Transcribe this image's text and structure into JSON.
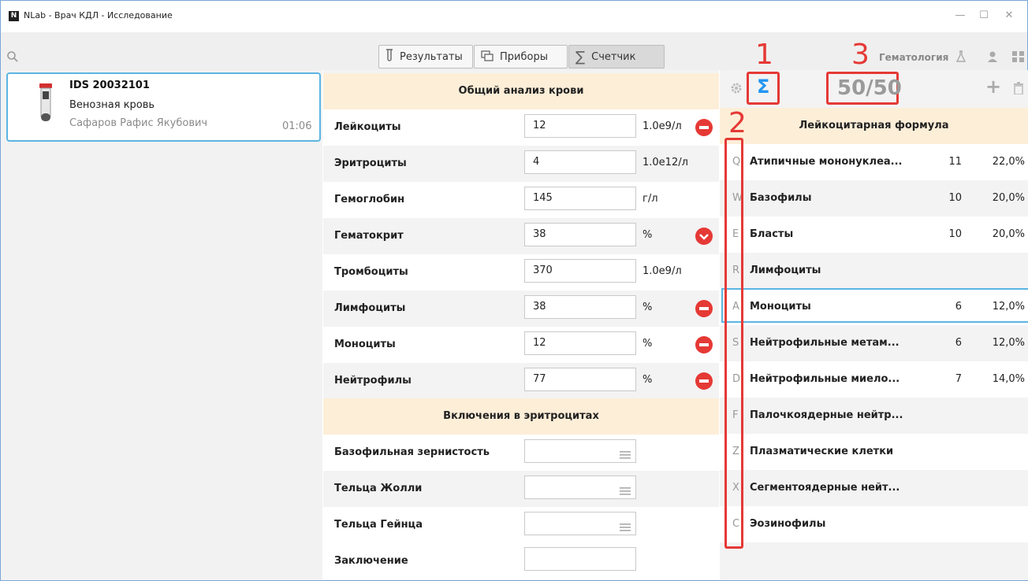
{
  "window": {
    "logo_letter": "N",
    "title": "NLab - Врач КДЛ - Исследование",
    "minimize": "—",
    "maximize": "☐",
    "close": "✕"
  },
  "toolbar": {
    "results_label": "Результаты",
    "devices_label": "Приборы",
    "counter_label": "Счетчик",
    "department": "Гематология"
  },
  "sample": {
    "id": "IDS 20032101",
    "material": "Венозная кровь",
    "patient": "Сафаров Рафис Якубович",
    "time": "01:06"
  },
  "cbc": {
    "section_title": "Общий анализ крови",
    "rows": [
      {
        "label": "Лейкоциты",
        "value": "12",
        "unit": "1.0e9/л",
        "flag": "high"
      },
      {
        "label": "Эритроциты",
        "value": "4",
        "unit": "1.0e12/л",
        "flag": ""
      },
      {
        "label": "Гемоглобин",
        "value": "145",
        "unit": "г/л",
        "flag": ""
      },
      {
        "label": "Гематокрит",
        "value": "38",
        "unit": "%",
        "flag": "low"
      },
      {
        "label": "Тромбоциты",
        "value": "370",
        "unit": "1.0e9/л",
        "flag": ""
      },
      {
        "label": "Лимфоциты",
        "value": "38",
        "unit": "%",
        "flag": "high"
      },
      {
        "label": "Моноциты",
        "value": "12",
        "unit": "%",
        "flag": "high"
      },
      {
        "label": "Нейтрофилы",
        "value": "77",
        "unit": "%",
        "flag": "high"
      }
    ]
  },
  "inclusions": {
    "section_title": "Включения в эритроцитах",
    "rows": [
      {
        "label": "Базофильная зернистость"
      },
      {
        "label": "Тельца Жолли"
      },
      {
        "label": "Тельца Гейнца"
      }
    ],
    "conclusion_label": "Заключение"
  },
  "counter": {
    "sigma": "Σ",
    "value": "50/50",
    "callouts": [
      "1",
      "2",
      "3"
    ],
    "section_title": "Лейкоцитарная формула",
    "rows": [
      {
        "key": "Q",
        "name": "Атипичные мононуклеа...",
        "count": "11",
        "pct": "22,0%"
      },
      {
        "key": "W",
        "name": "Базофилы",
        "count": "10",
        "pct": "20,0%"
      },
      {
        "key": "E",
        "name": "Бласты",
        "count": "10",
        "pct": "20,0%"
      },
      {
        "key": "R",
        "name": "Лимфоциты",
        "count": "",
        "pct": ""
      },
      {
        "key": "A",
        "name": "Моноциты",
        "count": "6",
        "pct": "12,0%"
      },
      {
        "key": "S",
        "name": "Нейтрофильные метам...",
        "count": "6",
        "pct": "12,0%"
      },
      {
        "key": "D",
        "name": "Нейтрофильные миело...",
        "count": "7",
        "pct": "14,0%"
      },
      {
        "key": "F",
        "name": "Палочкоядерные нейтр...",
        "count": "",
        "pct": ""
      },
      {
        "key": "Z",
        "name": "Плазматические клетки",
        "count": "",
        "pct": ""
      },
      {
        "key": "X",
        "name": "Сегментоядерные нейт...",
        "count": "",
        "pct": ""
      },
      {
        "key": "C",
        "name": "Эозинофилы",
        "count": "",
        "pct": ""
      }
    ]
  },
  "colors": {
    "accent": "#5bb5e2",
    "section_bg": "#fdeed8",
    "flag_red": "#e53935",
    "callout_red": "#e53935"
  }
}
